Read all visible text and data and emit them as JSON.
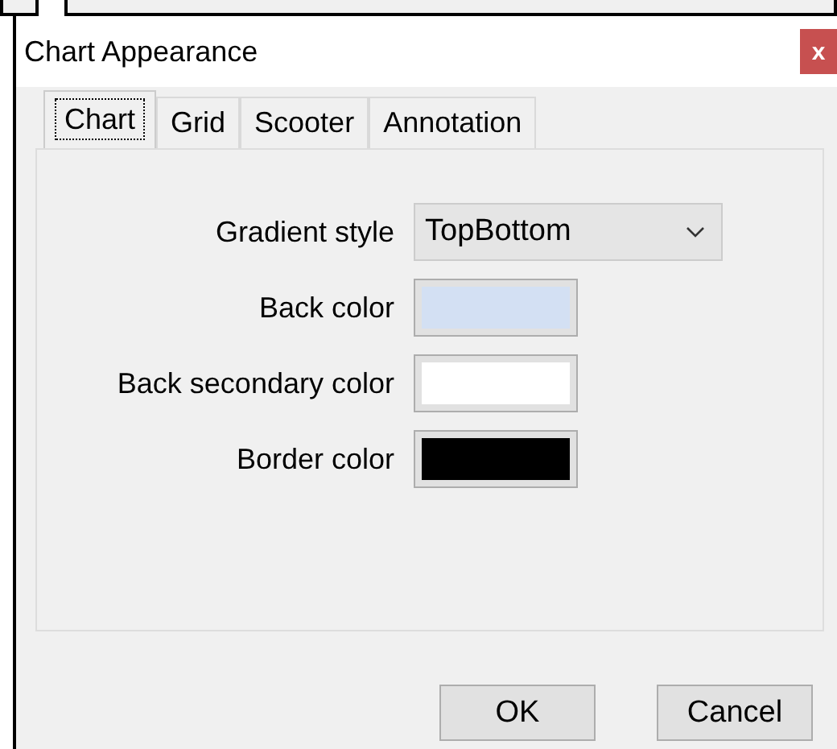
{
  "window": {
    "title": "Chart Appearance",
    "close": "x"
  },
  "tabs": [
    {
      "label": "Chart",
      "selected": true
    },
    {
      "label": "Grid",
      "selected": false
    },
    {
      "label": "Scooter",
      "selected": false
    },
    {
      "label": "Annotation",
      "selected": false
    }
  ],
  "fields": [
    {
      "kind": "dropdown",
      "label": "Gradient style",
      "value": "TopBottom"
    },
    {
      "kind": "color",
      "label": "Back color",
      "color": "#d3e0f3"
    },
    {
      "kind": "color",
      "label": "Back secondary color",
      "color": "#ffffff"
    },
    {
      "kind": "color",
      "label": "Border color",
      "color": "#000000"
    }
  ],
  "buttons": [
    "OK",
    "Cancel"
  ]
}
